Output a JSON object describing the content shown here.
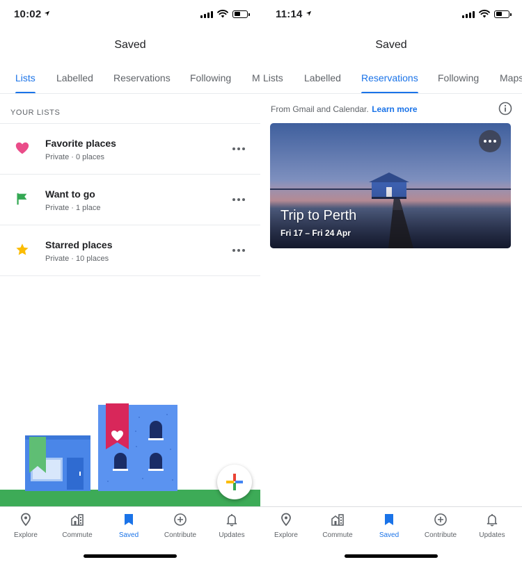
{
  "left": {
    "status": {
      "time": "10:02"
    },
    "title": "Saved",
    "tabs": [
      "Lists",
      "Labelled",
      "Reservations",
      "Following",
      "M"
    ],
    "active_tab": "Lists",
    "section_label": "YOUR LISTS",
    "lists": [
      {
        "name": "Favorite places",
        "meta": "Private · 0 places",
        "icon": "heart-icon",
        "color": "#ea4c89"
      },
      {
        "name": "Want to go",
        "meta": "Private · 1 place",
        "icon": "flag-icon",
        "color": "#34a853"
      },
      {
        "name": "Starred places",
        "meta": "Private · 10 places",
        "icon": "star-icon",
        "color": "#fbbc04"
      }
    ]
  },
  "right": {
    "status": {
      "time": "11:14"
    },
    "title": "Saved",
    "tabs": [
      "Lists",
      "Labelled",
      "Reservations",
      "Following",
      "Maps"
    ],
    "active_tab": "Reservations",
    "info": {
      "text": "From Gmail and Calendar.",
      "link": "Learn more"
    },
    "trip": {
      "title": "Trip to Perth",
      "dates": "Fri 17 – Fri 24 Apr"
    }
  },
  "nav": {
    "items": [
      {
        "label": "Explore",
        "icon": "location-pin-icon"
      },
      {
        "label": "Commute",
        "icon": "commute-buildings-icon"
      },
      {
        "label": "Saved",
        "icon": "bookmark-icon"
      },
      {
        "label": "Contribute",
        "icon": "add-circle-icon"
      },
      {
        "label": "Updates",
        "icon": "bell-icon"
      }
    ],
    "active": "Saved"
  },
  "colors": {
    "accent": "#1a73e8",
    "text_secondary": "#5f6368",
    "google_blue": "#4285f4",
    "google_red": "#ea4335",
    "google_yellow": "#fbbc04",
    "google_green": "#34a853"
  }
}
